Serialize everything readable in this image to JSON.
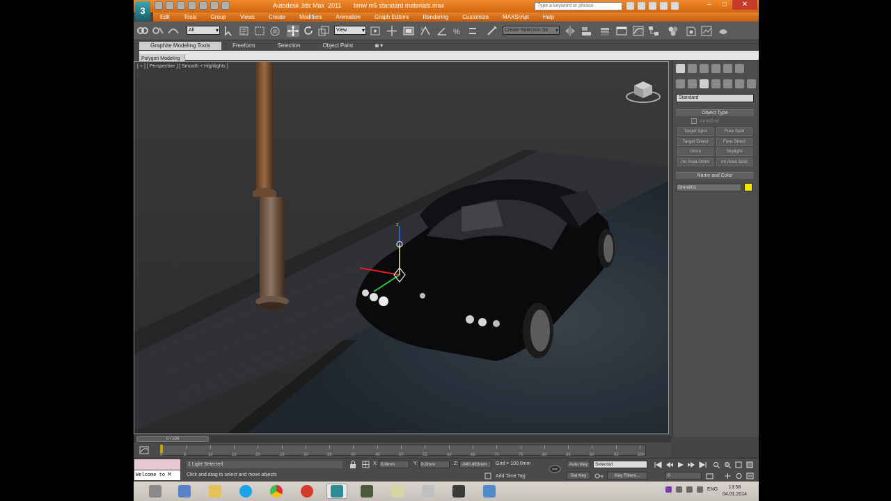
{
  "window": {
    "title": "Autodesk 3ds Max  2011       bmw m5 standard materials.max",
    "search_placeholder": "Type a keyword or phrase",
    "logo_text": "3",
    "controls": [
      "–",
      "□",
      "✕"
    ]
  },
  "menu": [
    "Edit",
    "Tools",
    "Group",
    "Views",
    "Create",
    "Modifiers",
    "Animation",
    "Graph Editors",
    "Rendering",
    "Customize",
    "MAXScript",
    "Help"
  ],
  "toolbar": {
    "selection_filter": "All",
    "ref_coord": "View",
    "named_selection": "Create Selection Se"
  },
  "ribbon": {
    "tabs": [
      "Graphite Modeling Tools",
      "Freeform",
      "Selection",
      "Object Paint"
    ],
    "active_tab": "Graphite Modeling Tools",
    "panel_label": "Polygon Modeling",
    "extra": "◙ ▾"
  },
  "viewport": {
    "label": "[ + ] [ Perspective ] [ Smooth + Highlights ]",
    "gizmo_axis_label": "z"
  },
  "command_panel": {
    "category": "Standard",
    "object_type_title": "Object Type",
    "autogrid_label": "AutoGrid",
    "buttons": [
      "Target Spot",
      "Free Spot",
      "Target Direct",
      "Free Direct",
      "Omni",
      "Skylight",
      "mr Area Omni",
      "mr Area Spot"
    ],
    "name_color_title": "Name and Color",
    "name_value": "Omni001",
    "object_color": "#f2e500"
  },
  "timeline": {
    "slider_label": "0 / 100",
    "ticks": [
      "0",
      "5",
      "10",
      "15",
      "20",
      "25",
      "30",
      "35",
      "40",
      "45",
      "50",
      "55",
      "60",
      "65",
      "70",
      "75",
      "80",
      "85",
      "90",
      "95",
      "100"
    ]
  },
  "status": {
    "maxscript_text": "Welcome to M",
    "selection": "1 Light Selected",
    "prompt": "Click and drag to select and move objects",
    "x_label": "X:",
    "x_value": "0,0mm",
    "y_label": "Y:",
    "y_value": "0,0mm",
    "z_label": "Z:",
    "z_value": "-940,463mm",
    "grid": "Grid = 100,0mm",
    "add_time_tag": "Add Time Tag",
    "auto_key": "Auto Key",
    "set_key": "Set Key",
    "key_mode": "Selected",
    "key_filters": "Key Filters...",
    "frame": "0"
  },
  "taskbar": {
    "language": "ENG",
    "time": "13:58",
    "date": "04.01.2014"
  }
}
